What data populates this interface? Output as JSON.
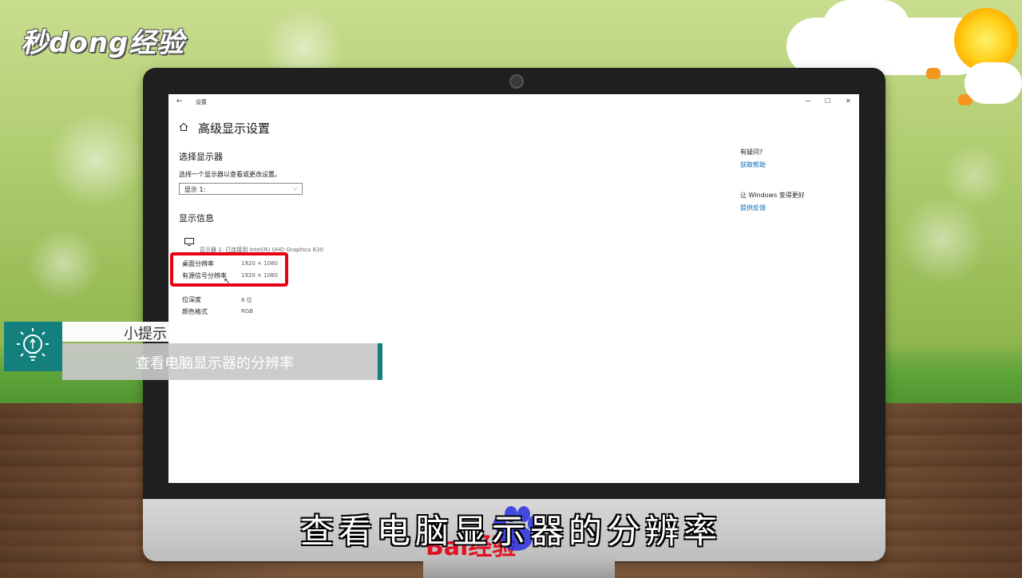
{
  "watermark": {
    "site_logo": "秒dong经验",
    "bottom_logo": "Bai经验"
  },
  "window": {
    "title": "设置",
    "back": "←",
    "controls": {
      "minimize": "—",
      "maximize": "☐",
      "close": "✕"
    }
  },
  "page": {
    "title": "高级显示设置",
    "choose_display": {
      "heading": "选择显示器",
      "hint": "选择一个显示器以查看或更改设置。",
      "selected": "显示 1:"
    },
    "display_info": {
      "heading": "显示信息",
      "monitor_caption": "显示器 1: 已连接到 Intel(R) UHD Graphics 630",
      "rows": [
        {
          "label": "桌面分辨率",
          "value": "1920 × 1080"
        },
        {
          "label": "有源信号分辨率",
          "value": "1920 × 1080"
        },
        {
          "label": "",
          "value": ""
        },
        {
          "label": "位深度",
          "value": "8 位"
        },
        {
          "label": "颜色格式",
          "value": "RGB"
        }
      ]
    }
  },
  "sidebar": {
    "help_heading": "有疑问?",
    "help_link": "获取帮助",
    "feedback_heading": "让 Windows 变得更好",
    "feedback_link": "提供反馈"
  },
  "tip": {
    "title": "小提示",
    "text": "查看电脑显示器的分辨率"
  },
  "subtitle": "查看电脑显示器的分辨率",
  "colors": {
    "accent": "#14807d",
    "highlight": "#e60012",
    "link": "#0067b8"
  }
}
